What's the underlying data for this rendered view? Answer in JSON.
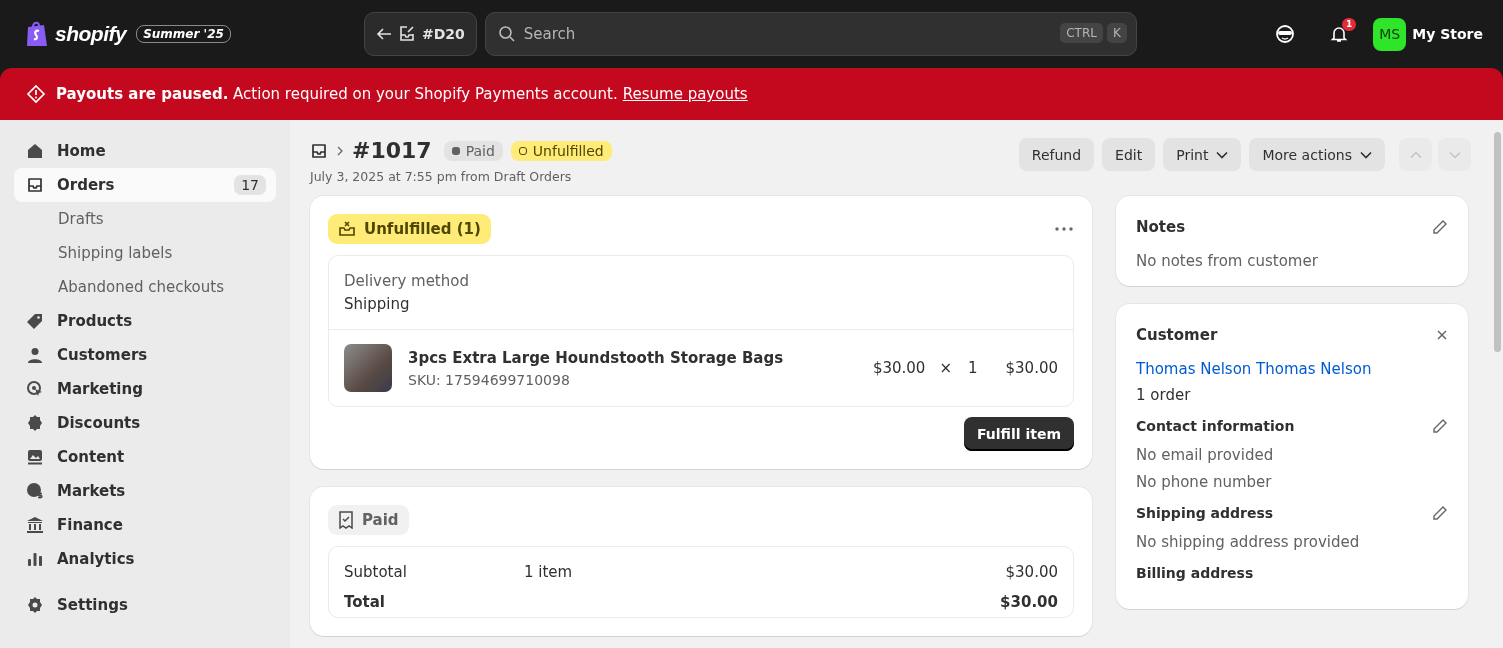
{
  "topbar": {
    "brand": "shopify",
    "edition": "Summer '25",
    "draft_button": "#D20",
    "search": {
      "placeholder": "Search",
      "keys": [
        "CTRL",
        "K"
      ]
    },
    "notification_count": "1",
    "store": {
      "initials": "MS",
      "name": "My Store"
    }
  },
  "banner": {
    "text": "**Payouts are paused.** Action required on your Shopify Payments account.",
    "link": "Resume payouts"
  },
  "sidebar": {
    "items": [
      {
        "label": "Home",
        "selected": false
      },
      {
        "label": "Orders",
        "selected": true,
        "count": "17",
        "children": [
          {
            "label": "Drafts",
            "selected": false
          },
          {
            "label": "Shipping labels",
            "selected": false
          },
          {
            "label": "Abandoned checkouts",
            "selected": false
          }
        ]
      },
      {
        "label": "Products",
        "selected": false
      },
      {
        "label": "Customers",
        "selected": false
      },
      {
        "label": "Marketing",
        "selected": false
      },
      {
        "label": "Discounts",
        "selected": false
      },
      {
        "label": "Content",
        "selected": false
      },
      {
        "label": "Markets",
        "selected": false
      },
      {
        "label": "Finance",
        "selected": false
      },
      {
        "label": "Analytics",
        "selected": false
      }
    ],
    "settings": "Settings"
  },
  "order": {
    "title": "#1017",
    "badges": [
      {
        "label": "Paid",
        "kind": "paid"
      },
      {
        "label": "Unfulfilled",
        "kind": "unfulfilled"
      }
    ],
    "subtitle": "July 3, 2025 at 7:55 pm from Draft Orders",
    "actions": [
      {
        "label": "Refund",
        "dropdown": false
      },
      {
        "label": "Edit",
        "dropdown": false
      },
      {
        "label": "Print",
        "dropdown": true
      },
      {
        "label": "More actions",
        "dropdown": true
      }
    ],
    "nav": [
      {
        "kind": "prev",
        "disabled": true
      },
      {
        "kind": "next",
        "disabled": true
      }
    ]
  },
  "fulfillment": {
    "status": "Unfulfilled (1)",
    "delivery_label": "Delivery method",
    "delivery_value": "Shipping",
    "items": [
      {
        "name": "3pcs Extra Large Houndstooth Storage Bags",
        "sku": "SKU: 17594699710098",
        "price": "$30.00",
        "times": "×",
        "quantity": "1",
        "total": "$30.00"
      }
    ],
    "button": "Fulfill item"
  },
  "payment": {
    "status": "Paid",
    "rows": [
      {
        "label": "Subtotal",
        "detail": "1 item",
        "amount": "$30.00",
        "kind": "normal"
      },
      {
        "label": "Total",
        "amount": "$30.00",
        "kind": "total"
      }
    ]
  },
  "notes": {
    "title": "Notes",
    "text": "No notes from customer"
  },
  "customer": {
    "title": "Customer",
    "name": "Thomas Nelson Thomas Nelson",
    "orders": "1 order",
    "sections": [
      {
        "title": "Contact information",
        "lines": [
          "No email provided",
          "No phone number"
        ],
        "editable": true
      },
      {
        "title": "Shipping address",
        "lines": [
          "No shipping address provided"
        ],
        "editable": true
      },
      {
        "title": "Billing address",
        "editable": false
      }
    ]
  }
}
